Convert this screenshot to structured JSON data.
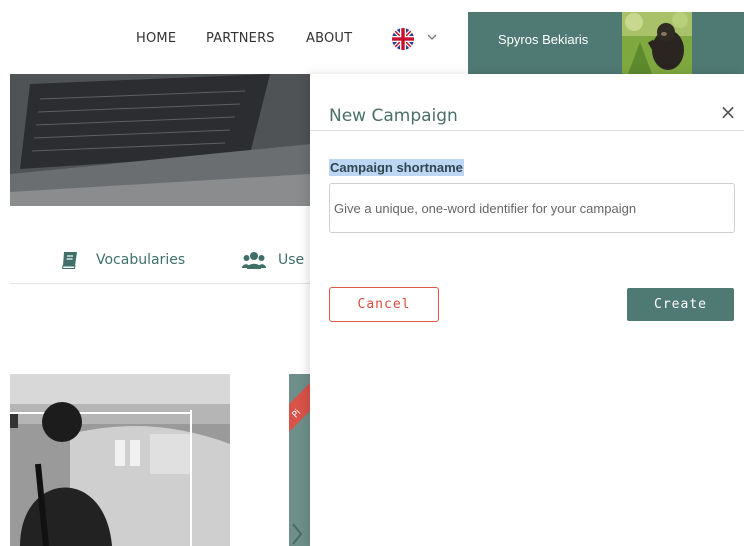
{
  "nav": {
    "links": [
      "HOME",
      "PARTNERS",
      "ABOUT"
    ],
    "language_icon": "uk-flag-icon",
    "user_name": "Spyros Bekiaris"
  },
  "tabs": [
    {
      "label": "Vocabularies",
      "icon": "book-icon"
    },
    {
      "label": "Use",
      "icon": "users-icon"
    }
  ],
  "card_ribbon_text": "Pi",
  "panel": {
    "title": "New Campaign",
    "close_label": "×",
    "field_label": "Campaign shortname",
    "field_placeholder": "Give a unique, one-word identifier for your campaign",
    "field_value": "",
    "cancel_label": "Cancel",
    "create_label": "Create"
  },
  "colors": {
    "brand": "#4f7a73",
    "danger": "#d84b3e",
    "highlight": "#bcd6f3"
  }
}
